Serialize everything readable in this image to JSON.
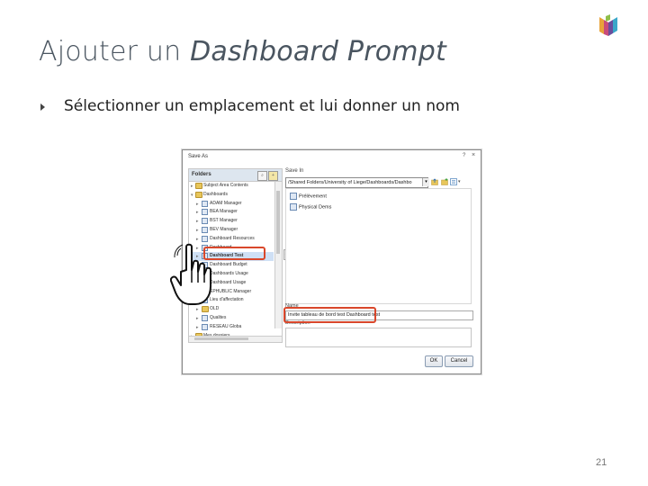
{
  "slide": {
    "title_plain": "Ajouter un ",
    "title_italic": "Dashboard Prompt",
    "bullet": "Sélectionner un emplacement et lui donner un nom",
    "page_number": "21"
  },
  "dialog": {
    "title": "Save As",
    "help": "?",
    "close": "×",
    "folders_header": "Folders",
    "tree": [
      {
        "label": "Subject Area Contents",
        "icon": "folder"
      },
      {
        "label": "Dashboards",
        "icon": "folder"
      },
      {
        "label": "ADAM Manager",
        "icon": "page"
      },
      {
        "label": "BEA Manager",
        "icon": "page"
      },
      {
        "label": "BST Manager",
        "icon": "page"
      },
      {
        "label": "BEV Manager",
        "icon": "page"
      },
      {
        "label": "Dashboard Resources",
        "icon": "page"
      },
      {
        "label": "Dashboard ",
        "icon": "page"
      },
      {
        "label": "Dashboard Test",
        "icon": "page"
      },
      {
        "label": "Dashboard Budget",
        "icon": "page"
      },
      {
        "label": "Dashboards Usage",
        "icon": "page"
      },
      {
        "label": "Dashboard Usage",
        "icon": "page"
      },
      {
        "label": "EPHUBLIC Manager",
        "icon": "page"
      },
      {
        "label": "Lieu d'affectation",
        "icon": "page"
      },
      {
        "label": "OLD",
        "icon": "folder"
      },
      {
        "label": "Qualites",
        "icon": "page"
      },
      {
        "label": "RESEAU Globa",
        "icon": "page"
      },
      {
        "label": "Mes dossiers",
        "icon": "folder"
      }
    ],
    "save_in_label": "Save In",
    "path": "/Shared Folders/University of Liege/Dashboards/Dashbo",
    "files": [
      "Prélèvement",
      "Physical Dems"
    ],
    "name_label": "Name",
    "name_value": "Invite tableau de bord test Dashboard test",
    "description_label": "Description",
    "ok_label": "OK",
    "cancel_label": "Cancel",
    "colors": {
      "highlight": "#d9472b",
      "header": "#dde6ef"
    }
  },
  "icons": [
    "university-logo-icon",
    "hand-pointer-icon",
    "folder-icon",
    "page-icon"
  ]
}
